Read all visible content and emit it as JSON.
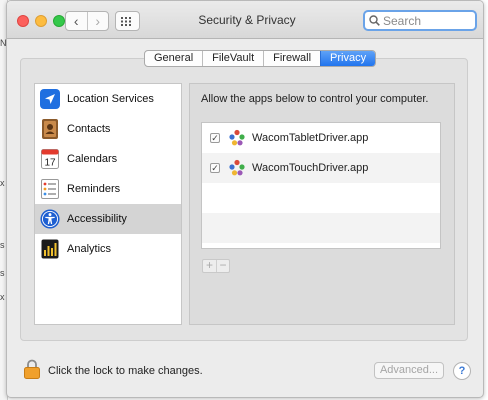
{
  "background_app": {
    "fragments": [
      "N",
      "x",
      "s",
      "s",
      "x"
    ]
  },
  "window": {
    "title": "Security & Privacy",
    "nav_back": "‹",
    "nav_forward": "›"
  },
  "search": {
    "placeholder": "Search"
  },
  "tabs": [
    {
      "label": "General",
      "active": false
    },
    {
      "label": "FileVault",
      "active": false
    },
    {
      "label": "Firewall",
      "active": false
    },
    {
      "label": "Privacy",
      "active": true
    }
  ],
  "sidebar": {
    "items": [
      {
        "label": "Location Services",
        "icon": "location-arrow-icon",
        "selected": false
      },
      {
        "label": "Contacts",
        "icon": "contacts-book-icon",
        "selected": false
      },
      {
        "label": "Calendars",
        "icon": "calendar-icon",
        "selected": false,
        "calendar_day": "17"
      },
      {
        "label": "Reminders",
        "icon": "reminders-list-icon",
        "selected": false
      },
      {
        "label": "Accessibility",
        "icon": "accessibility-icon",
        "selected": true
      },
      {
        "label": "Analytics",
        "icon": "analytics-icon",
        "selected": false
      }
    ]
  },
  "privacy_pane": {
    "heading": "Allow the apps below to control your computer.",
    "apps": [
      {
        "name": "WacomTabletDriver.app",
        "checked": true,
        "icon": "wacom-app-icon"
      },
      {
        "name": "WacomTouchDriver.app",
        "checked": true,
        "icon": "wacom-app-icon"
      }
    ],
    "checkmark": "✓",
    "add_label": "+",
    "remove_label": "−"
  },
  "footer": {
    "lock_text": "Click the lock to make changes.",
    "advanced_label": "Advanced...",
    "help_label": "?"
  },
  "colors": {
    "accent": "#2174ee",
    "selection": "#d4d4d4",
    "lock": "#f0a02c"
  }
}
